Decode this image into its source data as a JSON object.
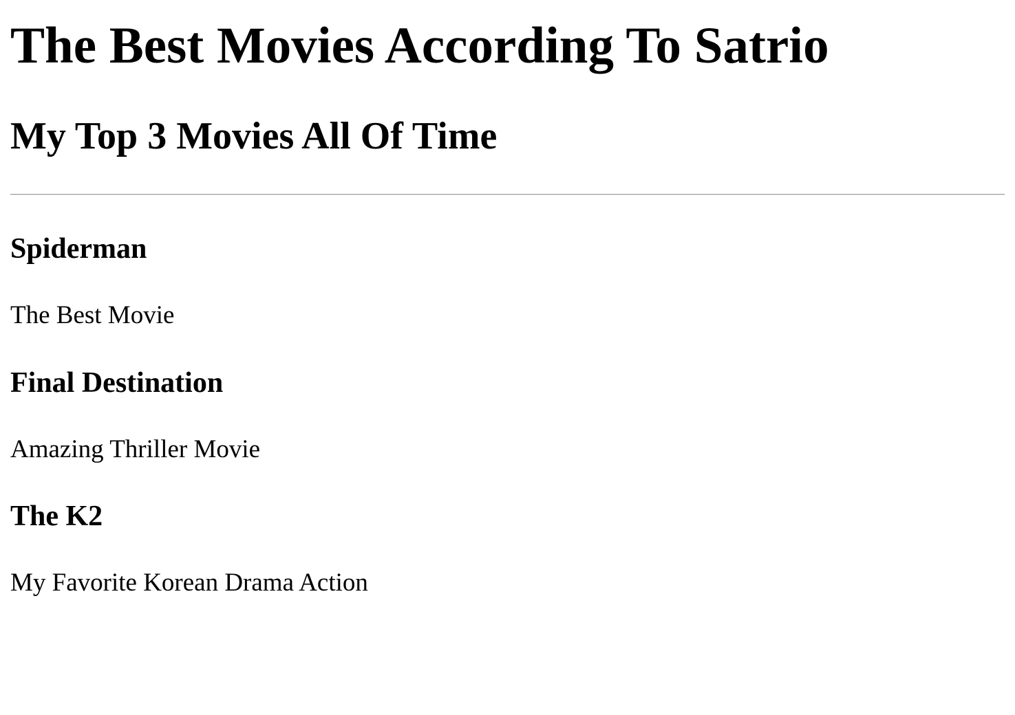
{
  "page": {
    "title": "The Best Movies According To Satrio",
    "subtitle": "My Top 3 Movies All Of Time"
  },
  "movies": [
    {
      "title": "Spiderman",
      "description": "The Best Movie"
    },
    {
      "title": "Final Destination",
      "description": "Amazing Thriller Movie"
    },
    {
      "title": "The K2",
      "description": "My Favorite Korean Drama Action"
    }
  ]
}
